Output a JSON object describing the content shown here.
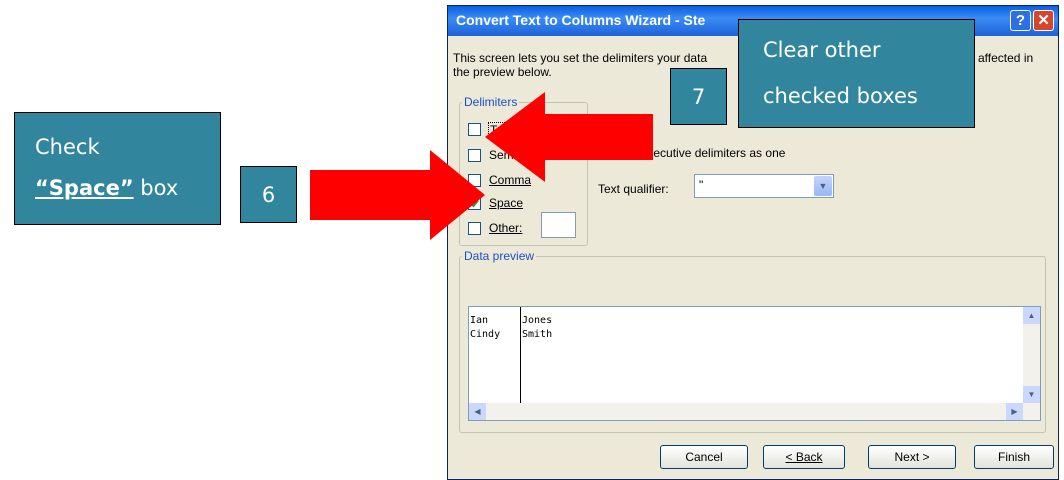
{
  "dialog": {
    "title": "Convert Text to Columns Wizard - Ste",
    "help_label": "?",
    "close_label": "✕",
    "description_left": "This screen lets you set the delimiters your data",
    "description_line2": "the preview below.",
    "description_right": "affected in",
    "delimiters": {
      "legend": "Delimiters",
      "items": [
        {
          "label": "Tab",
          "checked": false
        },
        {
          "label": "Semic",
          "checked": false
        },
        {
          "label": "Comma",
          "checked": false
        },
        {
          "label": "Space",
          "checked": true
        },
        {
          "label": "Other:",
          "checked": false
        }
      ]
    },
    "treat_consecutive_label": "consecutive delimiters as one",
    "text_qualifier": {
      "label": "Text qualifier:",
      "value": "\""
    },
    "data_preview": {
      "legend": "Data preview",
      "rows": [
        [
          "Ian",
          "Jones"
        ],
        [
          "Cindy",
          "Smith"
        ]
      ]
    },
    "buttons": {
      "cancel": "Cancel",
      "back": "< Back",
      "next": "Next >",
      "finish": "Finish"
    }
  },
  "callouts": {
    "check_line1": "Check",
    "check_space": "“Space”",
    "check_box": " box",
    "step6": "6",
    "step7": "7",
    "clear_line1": "Clear other",
    "clear_line2": "checked boxes"
  },
  "colors": {
    "callout": "#31859c",
    "arrow": "#ff0000",
    "titlebar": "#0a5fe0",
    "dialog_bg": "#ece9d8"
  }
}
